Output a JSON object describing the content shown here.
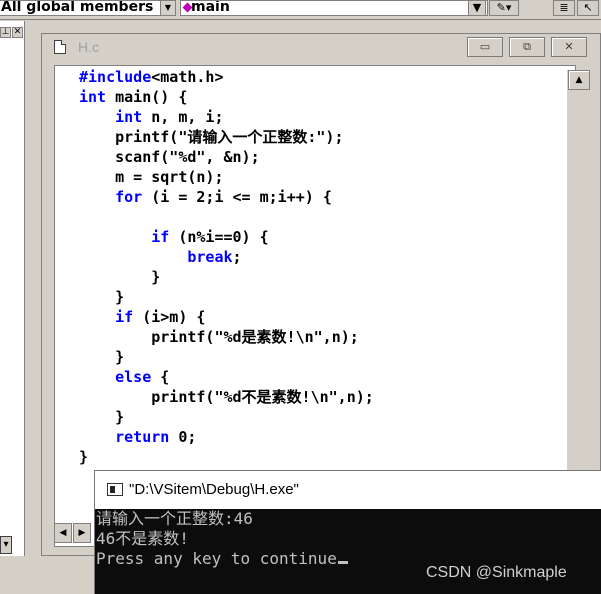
{
  "toolbar": {
    "members_combo": "All global members",
    "function_combo": "main"
  },
  "editor": {
    "title": "H.c",
    "minimize": "▭",
    "restore": "⧉",
    "close": "✕",
    "code_lines": [
      {
        "kw": "#include",
        "text": "<math.h>"
      },
      {
        "kw": "int",
        "text": " main() {"
      },
      {
        "kw": "    int",
        "text": " n, m, i;"
      },
      {
        "kw": "",
        "text": "    printf(\"请输入一个正整数:\");"
      },
      {
        "kw": "",
        "text": "    scanf(\"%d\", &n);"
      },
      {
        "kw": "",
        "text": "    m = sqrt(n);"
      },
      {
        "kw": "    for",
        "text": " (i = 2;i <= m;i++) {"
      },
      {
        "kw": "",
        "text": ""
      },
      {
        "kw": "        if",
        "text": " (n%i==0) {"
      },
      {
        "kw": "            break",
        "text": ";"
      },
      {
        "kw": "",
        "text": "        }"
      },
      {
        "kw": "",
        "text": "    }"
      },
      {
        "kw": "    if",
        "text": " (i>m) {"
      },
      {
        "kw": "",
        "text": "        printf(\"%d是素数!\\n\",n);"
      },
      {
        "kw": "",
        "text": "    }"
      },
      {
        "kw": "    else",
        "text": " {"
      },
      {
        "kw": "",
        "text": "        printf(\"%d不是素数!\\n\",n);"
      },
      {
        "kw": "",
        "text": "    }"
      },
      {
        "kw": "    return",
        "text": " 0;"
      },
      {
        "kw": "",
        "text": "}"
      }
    ]
  },
  "console": {
    "title": "\"D:\\VSitem\\Debug\\H.exe\"",
    "lines": [
      "请输入一个正整数:46",
      "46不是素数!",
      "Press any key to continue"
    ]
  },
  "watermark": "CSDN @Sinkmaple"
}
